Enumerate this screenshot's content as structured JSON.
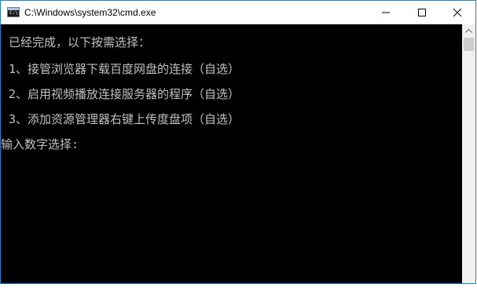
{
  "window": {
    "title": "C:\\Windows\\system32\\cmd.exe",
    "icon": "cmd-icon",
    "icon_prompt": "C:\\"
  },
  "titlebar_buttons": {
    "minimize": "minimize-icon",
    "maximize": "maximize-icon",
    "close": "close-icon"
  },
  "console": {
    "header": "已经完成，以下按需选择：",
    "options": [
      "1、接管浏览器下载百度网盘的连接（自选）",
      "2、启用视频播放连接服务器的程序（自选）",
      "3、添加资源管理器右键上传度盘项（自选）"
    ],
    "input_prompt": "输入数字选择:"
  },
  "colors": {
    "console_background": "#000000",
    "console_text": "#c0c0c0",
    "window_border": "#1883d7"
  }
}
